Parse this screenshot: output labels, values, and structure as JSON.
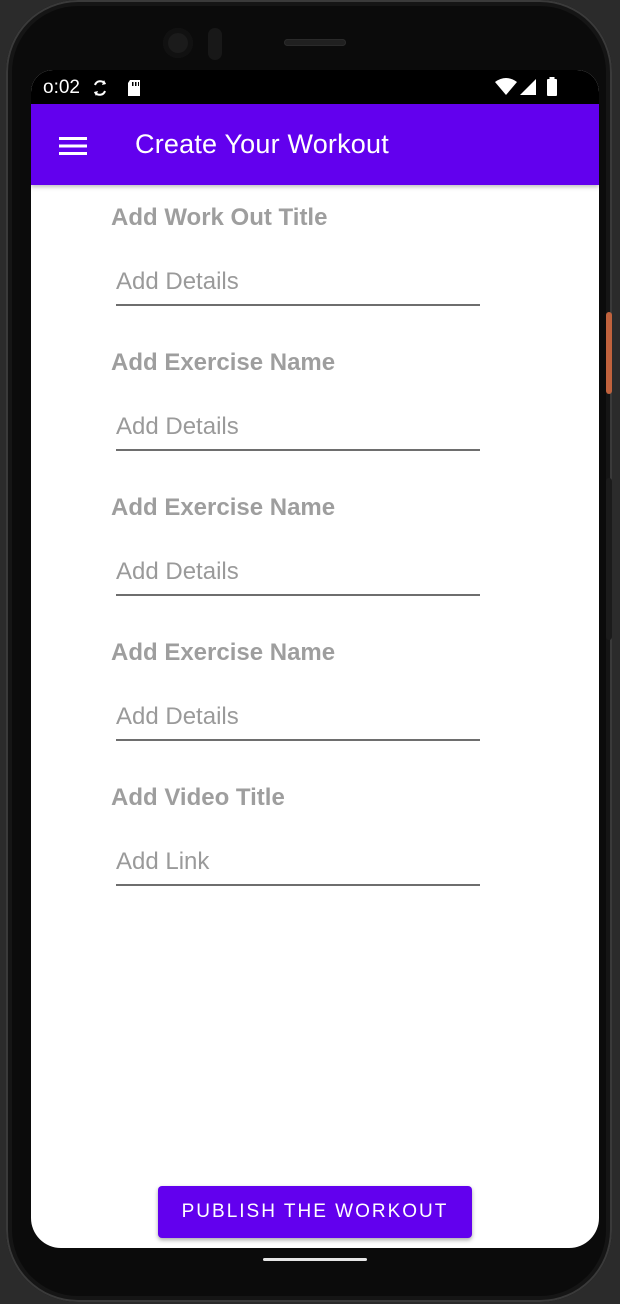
{
  "status_bar": {
    "time": "o:02",
    "icons": [
      "sync-icon",
      "sd-card-icon",
      "wifi-icon",
      "signal-icon",
      "battery-icon"
    ]
  },
  "app_bar": {
    "title": "Create Your Workout",
    "menu_icon": "hamburger-menu-icon",
    "color": "#6200ee"
  },
  "form": {
    "fields": [
      {
        "label": "Add Work Out Title",
        "placeholder": "Add Details",
        "value": ""
      },
      {
        "label": "Add Exercise Name",
        "placeholder": "Add Details",
        "value": ""
      },
      {
        "label": "Add Exercise Name",
        "placeholder": "Add Details",
        "value": ""
      },
      {
        "label": "Add Exercise Name",
        "placeholder": "Add Details",
        "value": ""
      },
      {
        "label": "Add Video Title",
        "placeholder": "Add Link",
        "value": ""
      }
    ]
  },
  "publish_button": {
    "label": "PUBLISH THE WORKOUT",
    "color": "#6200ee"
  },
  "colors": {
    "label_text": "#9e9e9e",
    "placeholder_text": "#9a9a9a",
    "underline": "#6e6e6e"
  }
}
